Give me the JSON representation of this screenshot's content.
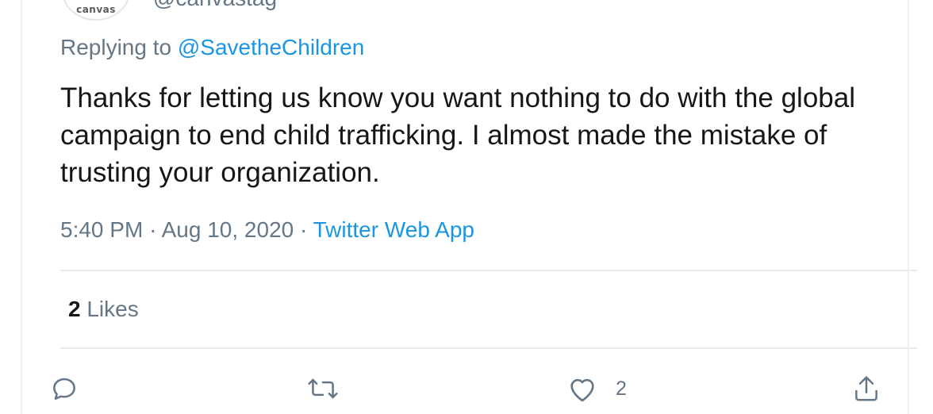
{
  "author": {
    "avatar_text": "canvas",
    "handle": "@canvastag"
  },
  "reply": {
    "prefix": "Replying to",
    "mention": "@SavetheChildren"
  },
  "tweet": {
    "text": "Thanks for letting us know you want nothing to do with the global campaign to end child trafficking. I almost made the mistake of trusting your organization."
  },
  "meta": {
    "time": "5:40 PM",
    "separator1": "·",
    "date": "Aug 10, 2020",
    "separator2": "·",
    "source": "Twitter Web App"
  },
  "stats": {
    "likes_count": "2",
    "likes_label": "Likes"
  },
  "actions": {
    "reply_icon": "reply-icon",
    "retweet_icon": "retweet-icon",
    "like_icon": "heart-icon",
    "like_count": "2",
    "share_icon": "share-icon"
  },
  "colors": {
    "link": "#1b95e0",
    "secondary_text": "#657786",
    "primary_text": "#14171a",
    "divider": "#e6ecf0"
  }
}
